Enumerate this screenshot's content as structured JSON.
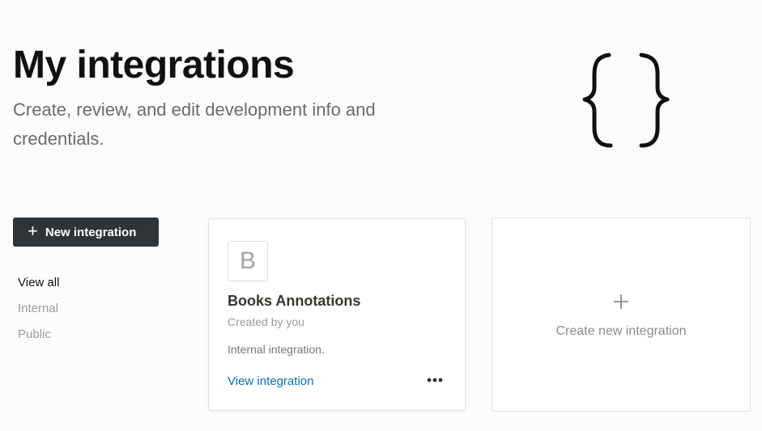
{
  "header": {
    "title": "My integrations",
    "subtitle": "Create, review, and edit development info and credentials."
  },
  "toolbar": {
    "new_integration_label": "New integration"
  },
  "filters": {
    "items": [
      {
        "label": "View all",
        "active": true
      },
      {
        "label": "Internal",
        "active": false
      },
      {
        "label": "Public",
        "active": false
      }
    ]
  },
  "integrations": [
    {
      "avatar_letter": "B",
      "name": "Books Annotations",
      "creator": "Created by you",
      "type": "Internal integration.",
      "view_label": "View integration"
    }
  ],
  "create_card": {
    "label": "Create new integration"
  },
  "icons": {
    "plus": "plus-icon",
    "more": "more-horizontal-icon",
    "illustration": "curly-braces-illustration"
  },
  "colors": {
    "primary_button": "#2f3437",
    "link": "#0b6fb6",
    "background": "#fdfcfb"
  }
}
